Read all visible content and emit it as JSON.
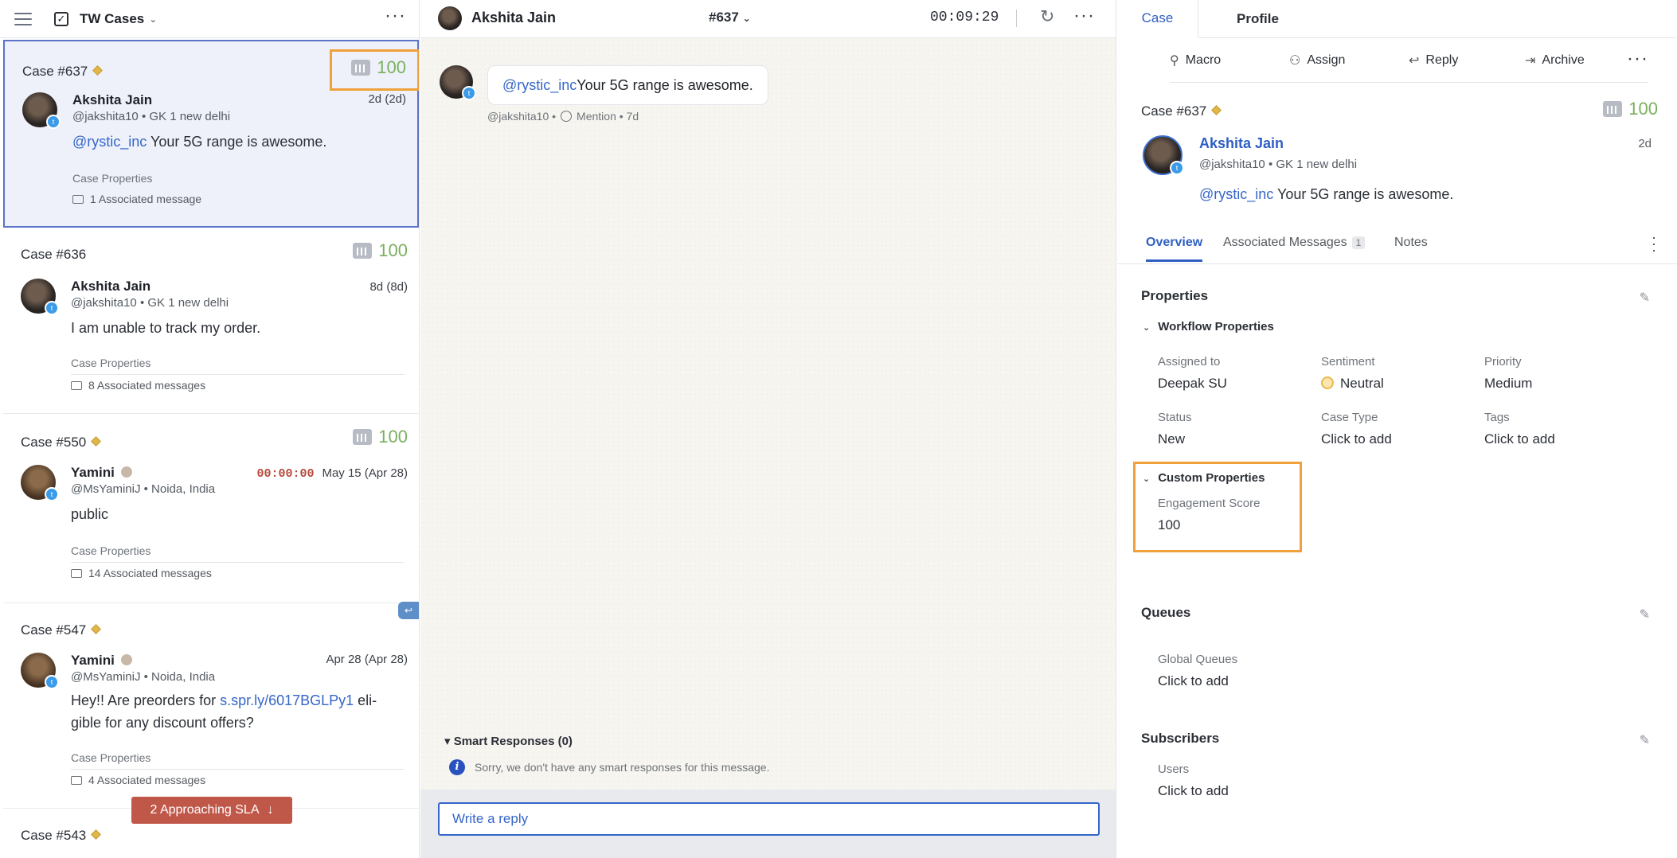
{
  "left": {
    "title": "TW Cases",
    "cases": [
      {
        "case": "Case #637",
        "score": "100",
        "name": "Akshita Jain",
        "handle": "@jakshita10 • GK 1 new delhi",
        "date": "2d (2d)",
        "mention": "@rystic_inc",
        "message": " Your 5G range is awesome.",
        "props": "Case Properties",
        "assoc": "1 Associated message"
      },
      {
        "case": "Case #636",
        "score": "100",
        "name": "Akshita Jain",
        "handle": "@jakshita10 • GK 1 new delhi",
        "date": "8d (8d)",
        "message": "I am unable to track my order.",
        "props": "Case Properties",
        "assoc": "8 Associated messages"
      },
      {
        "case": "Case #550",
        "score": "100",
        "name": "Yamini",
        "handle": "@MsYaminiJ • Noida, India",
        "sla": "00:00:00",
        "date": "May 15 (Apr 28)",
        "message": "public",
        "props": "Case Properties",
        "assoc": "14 Associated messages"
      },
      {
        "case": "Case #547",
        "name": "Yamini",
        "handle": "@MsYaminiJ • Noida, India",
        "date": "Apr 28 (Apr 28)",
        "message_pre": "Hey!! Are preorders for ",
        "link": "s.spr.ly/6017BGLPy1",
        "message_post": " eli-gible for any discount offers?",
        "props": "Case Properties",
        "assoc": "4 Associated messages"
      },
      {
        "case": "Case #543"
      }
    ],
    "approaching_sla": "2 Approaching SLA",
    "approaching_arrow": "↓"
  },
  "middle": {
    "name": "Akshita Jain",
    "case": "#637",
    "timer": "00:09:29",
    "mention": "@rystic_inc",
    "message": " Your 5G range is awesome.",
    "meta_handle": "@jakshita10 •",
    "meta_type": "Mention • 7d",
    "smart_title": "Smart Responses (0)",
    "smart_info": "Sorry, we don't have any smart responses for this message.",
    "reply_placeholder": "Write a reply"
  },
  "right": {
    "tabs": [
      "Case",
      "Profile"
    ],
    "toolbar": [
      "Macro",
      "Assign",
      "Reply",
      "Archive"
    ],
    "case": "Case #637",
    "score": "100",
    "name": "Akshita Jain",
    "handle": "@jakshita10 • GK 1 new delhi",
    "date": "2d",
    "mention": "@rystic_inc",
    "message": " Your 5G range is awesome.",
    "subtabs": {
      "overview": "Overview",
      "associated": "Associated Messages",
      "associated_count": "1",
      "notes": "Notes"
    },
    "properties": {
      "title": "Properties",
      "workflow": "Workflow Properties",
      "assigned_label": "Assigned to",
      "assigned_value": "Deepak SU",
      "sentiment_label": "Sentiment",
      "sentiment_value": "Neutral",
      "priority_label": "Priority",
      "priority_value": "Medium",
      "status_label": "Status",
      "status_value": "New",
      "casetype_label": "Case Type",
      "casetype_value": "Click to add",
      "tags_label": "Tags",
      "tags_value": "Click to add",
      "custom": "Custom Properties",
      "engagement_label": "Engagement Score",
      "engagement_value": "100"
    },
    "queues": {
      "title": "Queues",
      "label": "Global Queues",
      "value": "Click to add"
    },
    "subscribers": {
      "title": "Subscribers",
      "label": "Users",
      "value": "Click to add"
    }
  },
  "colors": {
    "accent": "#2f5fc4",
    "score": "#7bb05f",
    "highlight": "#f0a13b",
    "sla": "#c0584a"
  }
}
